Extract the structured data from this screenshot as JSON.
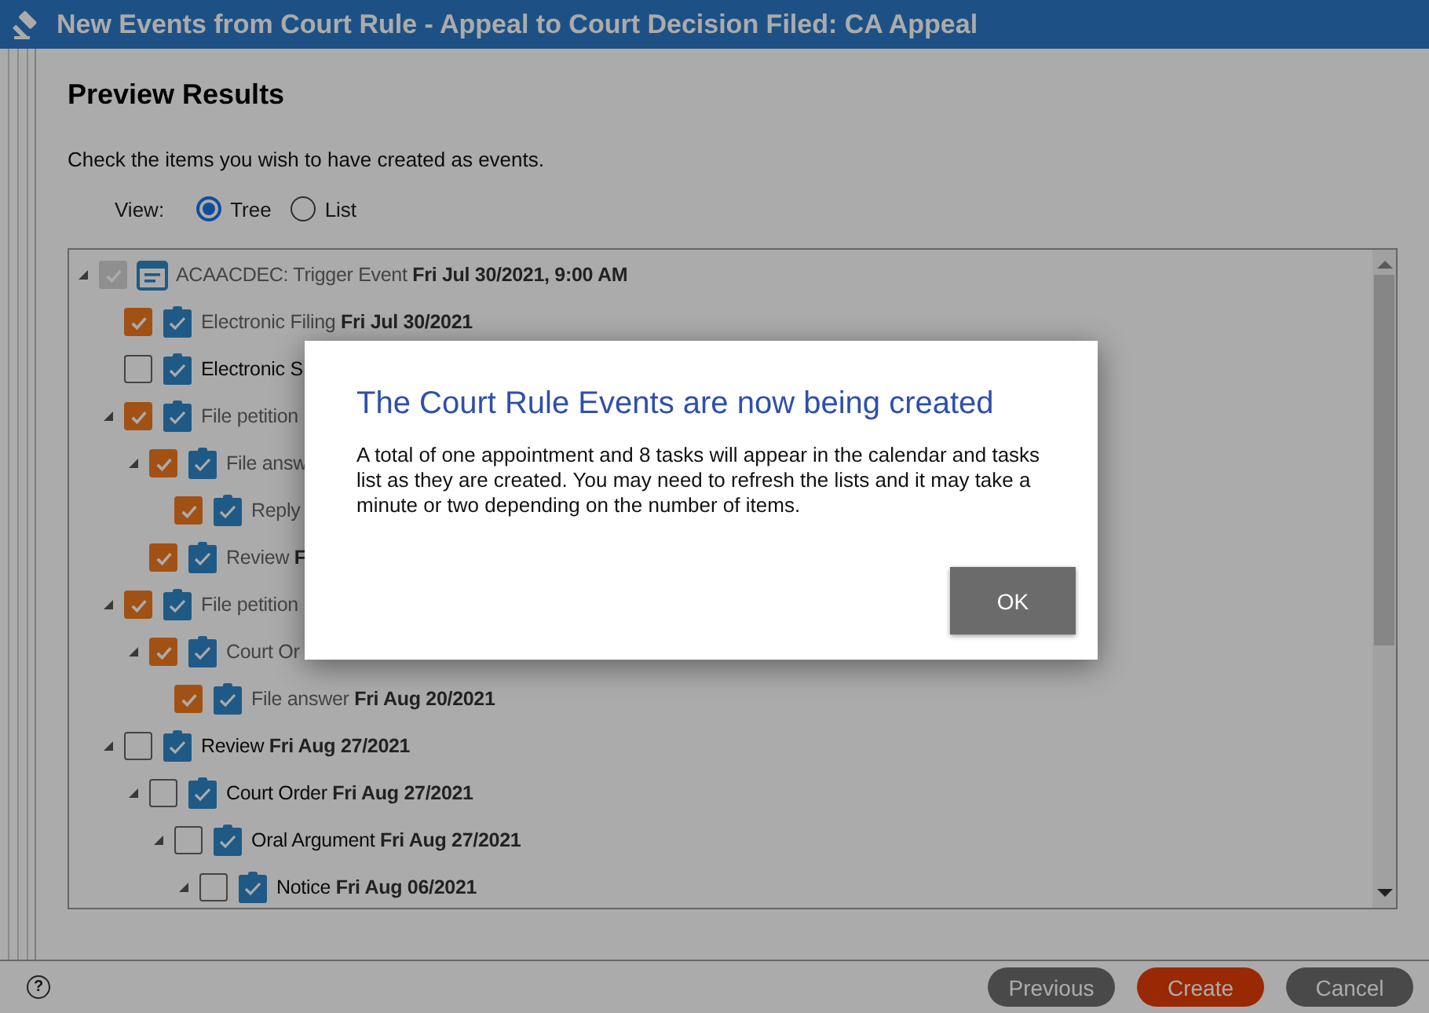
{
  "window": {
    "title": "New Events from Court Rule - Appeal to Court Decision Filed: CA Appeal"
  },
  "heading": "Preview Results",
  "instruction": "Check the items you wish to have created as events.",
  "view": {
    "label": "View:",
    "options": [
      {
        "label": "Tree",
        "selected": true
      },
      {
        "label": "List",
        "selected": false
      }
    ]
  },
  "tree": [
    {
      "kind": "appointment",
      "name": "ACAACDEC: Trigger Event",
      "date": "Fri Jul 30/2021, 9:00 AM",
      "checked": true,
      "disabled": true,
      "expanded": true,
      "children": [
        {
          "kind": "task",
          "name": "Electronic Filing",
          "date": "Fri Jul 30/2021",
          "checked": true
        },
        {
          "kind": "task",
          "name": "Electronic S",
          "checked": false
        },
        {
          "kind": "task",
          "name": "File petition",
          "checked": true,
          "expanded": true,
          "children": [
            {
              "kind": "task",
              "name": "File answ",
              "checked": true,
              "expanded": true,
              "children": [
                {
                  "kind": "task",
                  "name": "Reply",
                  "checked": true
                }
              ]
            },
            {
              "kind": "task",
              "name": "Review",
              "date": "F",
              "checked": true
            }
          ]
        },
        {
          "kind": "task",
          "name": "File petition",
          "checked": true,
          "expanded": true,
          "children": [
            {
              "kind": "task",
              "name": "Court Or",
              "checked": true,
              "expanded": true,
              "children": [
                {
                  "kind": "task",
                  "name": "File answer",
                  "date": "Fri Aug 20/2021",
                  "checked": true
                }
              ]
            }
          ]
        },
        {
          "kind": "task",
          "name": "Review",
          "date": "Fri Aug 27/2021",
          "checked": false,
          "expanded": true,
          "children": [
            {
              "kind": "task",
              "name": "Court Order",
              "date": "Fri Aug 27/2021",
              "checked": false,
              "expanded": true,
              "children": [
                {
                  "kind": "task",
                  "name": "Oral Argument",
                  "date": "Fri Aug 27/2021",
                  "checked": false,
                  "expanded": true,
                  "children": [
                    {
                      "kind": "task",
                      "name": "Notice",
                      "date": "Fri Aug 06/2021",
                      "checked": false,
                      "expanded": true
                    }
                  ]
                }
              ]
            }
          ]
        }
      ]
    }
  ],
  "footer": {
    "help": "?",
    "buttons": [
      {
        "label": "Previous",
        "kind": "secondary"
      },
      {
        "label": "Create",
        "kind": "primary"
      },
      {
        "label": "Cancel",
        "kind": "secondary"
      }
    ]
  },
  "modal": {
    "title": "The Court Rule Events are now being created",
    "message": "A total of one appointment and 8 tasks will appear in the calendar and tasks list as they are created. You may need to refresh the lists and it may take a minute or two depending on the number of items.",
    "button": "OK"
  }
}
